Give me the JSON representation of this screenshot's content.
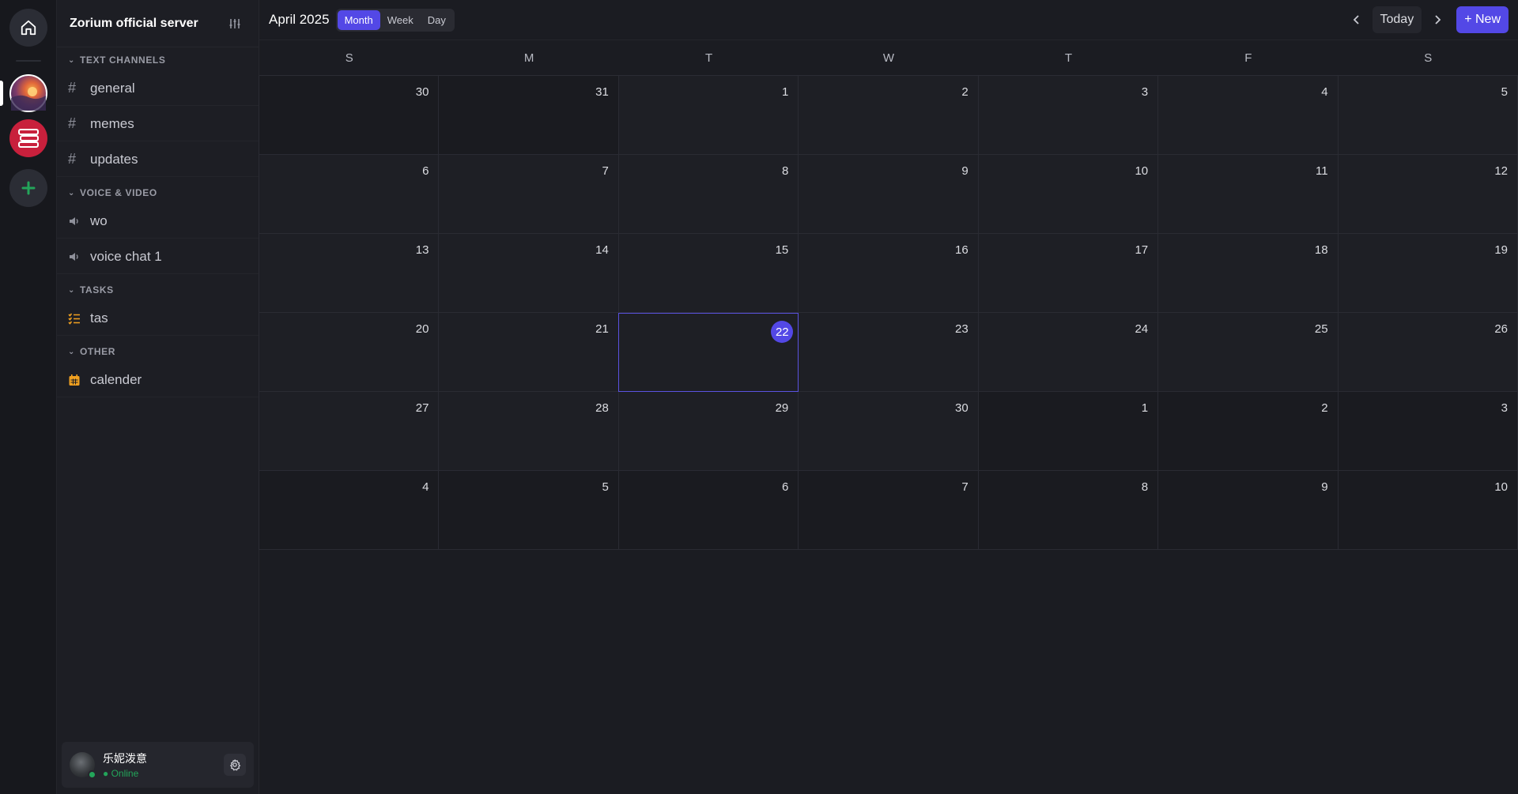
{
  "server": {
    "name": "Zorium official server"
  },
  "categories": {
    "text": "TEXT CHANNELS",
    "voice": "VOICE & VIDEO",
    "tasks": "TASKS",
    "other": "OTHER"
  },
  "channels": {
    "text": [
      {
        "label": "general",
        "icon": "hash-icon"
      },
      {
        "label": "memes",
        "icon": "hash-icon"
      },
      {
        "label": "updates",
        "icon": "hash-icon"
      }
    ],
    "voice": [
      {
        "label": "wo",
        "icon": "speaker-icon"
      },
      {
        "label": "voice chat 1",
        "icon": "speaker-icon"
      }
    ],
    "tasks": [
      {
        "label": "tas",
        "icon": "task-list-icon"
      }
    ],
    "other": [
      {
        "label": "calender",
        "icon": "calendar-icon"
      }
    ]
  },
  "user": {
    "name": "乐妮泼意",
    "status": "Online"
  },
  "toolbar": {
    "month_title": "April 2025",
    "view_month": "Month",
    "view_week": "Week",
    "view_day": "Day",
    "today_label": "Today",
    "new_label": "+ New"
  },
  "calendar": {
    "weekdays": [
      "S",
      "M",
      "T",
      "W",
      "T",
      "F",
      "S"
    ],
    "today": 22,
    "days": [
      {
        "d": "30",
        "in": false
      },
      {
        "d": "31",
        "in": false
      },
      {
        "d": "1",
        "in": true
      },
      {
        "d": "2",
        "in": true
      },
      {
        "d": "3",
        "in": true
      },
      {
        "d": "4",
        "in": true
      },
      {
        "d": "5",
        "in": true
      },
      {
        "d": "6",
        "in": true
      },
      {
        "d": "7",
        "in": true
      },
      {
        "d": "8",
        "in": true
      },
      {
        "d": "9",
        "in": true
      },
      {
        "d": "10",
        "in": true
      },
      {
        "d": "11",
        "in": true
      },
      {
        "d": "12",
        "in": true
      },
      {
        "d": "13",
        "in": true
      },
      {
        "d": "14",
        "in": true
      },
      {
        "d": "15",
        "in": true
      },
      {
        "d": "16",
        "in": true
      },
      {
        "d": "17",
        "in": true
      },
      {
        "d": "18",
        "in": true
      },
      {
        "d": "19",
        "in": true
      },
      {
        "d": "20",
        "in": true
      },
      {
        "d": "21",
        "in": true
      },
      {
        "d": "22",
        "in": true
      },
      {
        "d": "23",
        "in": true
      },
      {
        "d": "24",
        "in": true
      },
      {
        "d": "25",
        "in": true
      },
      {
        "d": "26",
        "in": true
      },
      {
        "d": "27",
        "in": true
      },
      {
        "d": "28",
        "in": true
      },
      {
        "d": "29",
        "in": true
      },
      {
        "d": "30",
        "in": true
      },
      {
        "d": "1",
        "in": false
      },
      {
        "d": "2",
        "in": false
      },
      {
        "d": "3",
        "in": false
      },
      {
        "d": "4",
        "in": false
      },
      {
        "d": "5",
        "in": false
      },
      {
        "d": "6",
        "in": false
      },
      {
        "d": "7",
        "in": false
      },
      {
        "d": "8",
        "in": false
      },
      {
        "d": "9",
        "in": false
      },
      {
        "d": "10",
        "in": false
      }
    ]
  },
  "colors": {
    "accent": "#5348e6",
    "online": "#23a55a",
    "task_icon": "#f0a020"
  }
}
